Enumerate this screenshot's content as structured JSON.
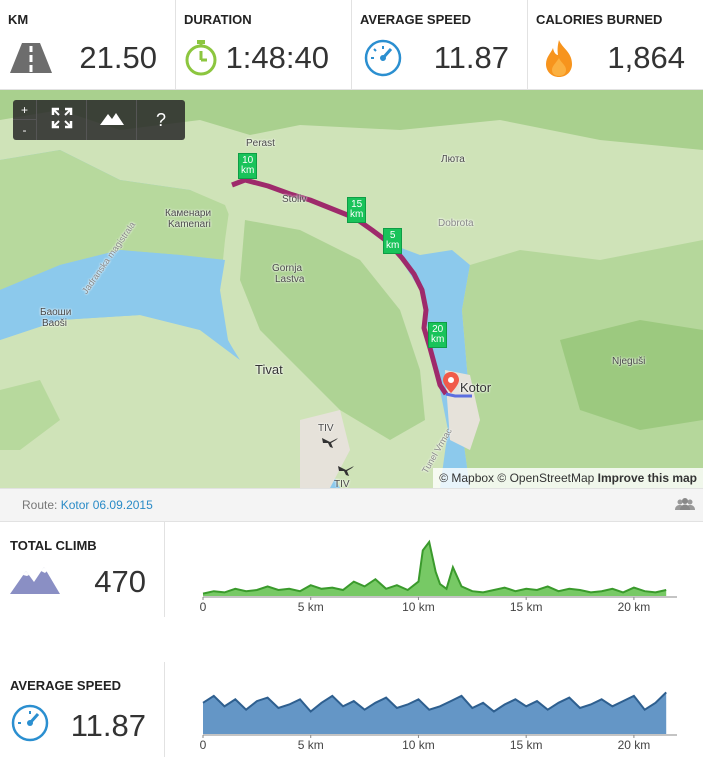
{
  "stats": [
    {
      "label": "KM",
      "value": "21.50",
      "icon": "road-icon"
    },
    {
      "label": "DURATION",
      "value": "1:48:40",
      "icon": "stopwatch-icon"
    },
    {
      "label": "AVERAGE SPEED",
      "value": "11.87",
      "icon": "speedometer-icon"
    },
    {
      "label": "CALORIES BURNED",
      "value": "1,864",
      "icon": "flame-icon"
    }
  ],
  "map": {
    "controls": {
      "zoom_in": "+",
      "zoom_out": "-",
      "help": "?"
    },
    "labels": {
      "perast": "Perast",
      "ljuta": "Люта",
      "stoliv": "Stoliv",
      "dobrota": "Dobrota",
      "kamenari_cyr": "Каменари",
      "kamenari": "Kamenari",
      "gornja": "Gornja",
      "lastva": "Lastva",
      "baosi_cyr": "Баоши",
      "baosi": "Baoši",
      "tivat": "Tivat",
      "kotor": "Kotor",
      "njegusi": "Njeguši",
      "tiv1": "TIV",
      "tiv2": "TIV",
      "jadranska": "Jadranska magistrala",
      "vrmac": "Tunel Vrmac"
    },
    "km_markers": [
      {
        "line1": "10",
        "line2": "km"
      },
      {
        "line1": "15",
        "line2": "km"
      },
      {
        "line1": "5",
        "line2": "km"
      },
      {
        "line1": "20",
        "line2": "km"
      }
    ],
    "attribution": {
      "mapbox": "© Mapbox",
      "osm": "© OpenStreetMap",
      "improve": "Improve this map"
    },
    "colors": {
      "water": "#8cc9ec",
      "land": "#cfe3b8",
      "route": "#9e2a6b",
      "marker": "#19c35a",
      "pin": "#f05a4a"
    }
  },
  "route": {
    "prefix": "Route:",
    "name": "Kotor 06.09.2015",
    "icon": "group-icon"
  },
  "metrics": [
    {
      "label": "TOTAL CLIMB",
      "value": "470",
      "icon": "mountain-icon"
    },
    {
      "label": "AVERAGE SPEED",
      "value": "11.87",
      "icon": "speedometer-icon"
    }
  ],
  "chart_data": [
    {
      "type": "area",
      "title": "",
      "x_ticks": [
        "0",
        "5 km",
        "10 km",
        "15 km",
        "20 km"
      ],
      "xlim": [
        0,
        22
      ],
      "color": "#3a9a2c",
      "x": [
        0,
        0.5,
        1,
        1.5,
        2,
        2.5,
        3,
        3.5,
        4,
        4.5,
        5,
        5.5,
        6,
        6.5,
        7,
        7.5,
        8,
        8.5,
        9,
        9.5,
        10,
        10.2,
        10.5,
        10.8,
        11,
        11.3,
        11.6,
        12,
        12.5,
        13,
        13.5,
        14,
        14.5,
        15,
        15.5,
        16,
        16.5,
        17,
        17.5,
        18,
        18.5,
        19,
        19.5,
        20,
        20.5,
        21,
        21.5
      ],
      "values": [
        2,
        4,
        3,
        6,
        4,
        5,
        8,
        5,
        6,
        4,
        9,
        6,
        7,
        5,
        12,
        8,
        14,
        6,
        9,
        5,
        12,
        38,
        45,
        20,
        10,
        6,
        24,
        8,
        4,
        3,
        5,
        7,
        4,
        6,
        5,
        8,
        4,
        6,
        5,
        3,
        4,
        6,
        3,
        7,
        4,
        3,
        5
      ]
    },
    {
      "type": "line",
      "title": "",
      "x_ticks": [
        "0",
        "5 km",
        "10 km",
        "15 km",
        "20 km"
      ],
      "xlim": [
        0,
        22
      ],
      "color": "#2e5f8f",
      "x": [
        0,
        0.5,
        1,
        1.5,
        2,
        2.5,
        3,
        3.5,
        4,
        4.5,
        5,
        5.5,
        6,
        6.5,
        7,
        7.5,
        8,
        8.5,
        9,
        9.5,
        10,
        10.5,
        11,
        11.5,
        12,
        12.5,
        13,
        13.5,
        14,
        14.5,
        15,
        15.5,
        16,
        16.5,
        17,
        17.5,
        18,
        18.5,
        19,
        19.5,
        20,
        20.5,
        21,
        21.5
      ],
      "values": [
        18,
        22,
        16,
        20,
        14,
        19,
        21,
        15,
        17,
        20,
        13,
        18,
        22,
        16,
        19,
        14,
        18,
        21,
        15,
        17,
        20,
        14,
        16,
        19,
        22,
        15,
        18,
        13,
        17,
        20,
        16,
        19,
        14,
        18,
        21,
        15,
        17,
        20,
        16,
        19,
        22,
        14,
        18,
        24
      ]
    }
  ]
}
